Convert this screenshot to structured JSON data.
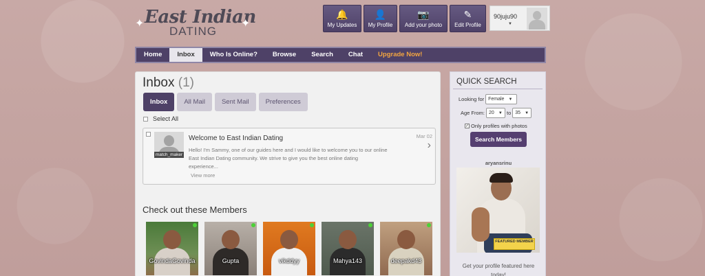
{
  "logo": {
    "main": "East Indian",
    "sub": "DATING",
    "ornament_left": "✦",
    "ornament_right": "✦"
  },
  "top_buttons": [
    {
      "label": "My Updates",
      "icon": "🔔",
      "icon_name": "bell-icon"
    },
    {
      "label": "My Profile",
      "icon": "👤",
      "icon_name": "person-icon"
    },
    {
      "label": "Add your photo",
      "icon": "📷",
      "icon_name": "camera-icon"
    },
    {
      "label": "Edit Profile",
      "icon": "✎",
      "icon_name": "pencil-icon"
    }
  ],
  "user": {
    "name": "90juju90",
    "caret": "▼"
  },
  "nav": [
    {
      "label": "Home"
    },
    {
      "label": "Inbox"
    },
    {
      "label": "Who Is Online?"
    },
    {
      "label": "Browse"
    },
    {
      "label": "Search"
    },
    {
      "label": "Chat"
    },
    {
      "label": "Upgrade Now!"
    }
  ],
  "inbox": {
    "title": "Inbox",
    "count": "(1)",
    "tabs": [
      "Inbox",
      "All Mail",
      "Sent Mail",
      "Preferences"
    ],
    "select_all": "Select All"
  },
  "message": {
    "sender": "match_maker",
    "title": "Welcome to East Indian Dating",
    "body": "Hello! I'm Sammy, one of our guides here and I would like to welcome you to our online East Indian Dating community. We strive to give you the best online dating experience...",
    "date": "Mar 02",
    "arrow": "›",
    "view_more": "View more"
  },
  "members_section": {
    "title": "Check out these Members",
    "members": [
      {
        "name": "GovindaGovinda"
      },
      {
        "name": "Gupta"
      },
      {
        "name": "vikddyy"
      },
      {
        "name": "Mahya143"
      },
      {
        "name": "deepakd43"
      }
    ]
  },
  "quick_search": {
    "title": "QUICK SEARCH",
    "looking_for_label": "Looking for",
    "looking_for_value": "Female",
    "age_from_label": "Age From:",
    "age_from_value": "20",
    "age_to_label": "to",
    "age_to_value": "35",
    "photos_only_label": "Only profiles with photos",
    "photos_only_checked": "✓",
    "dropdown_arrow": "▼",
    "search_button": "Search Members"
  },
  "featured": {
    "name": "aryansrinu",
    "badge": "FEATURED MEMBER",
    "cta": "Get your profile featured here today!"
  },
  "colors": {
    "purple": "#4e4167",
    "upgrade": "#f4a640",
    "online": "#4cd137",
    "badge": "#f3d34b"
  }
}
